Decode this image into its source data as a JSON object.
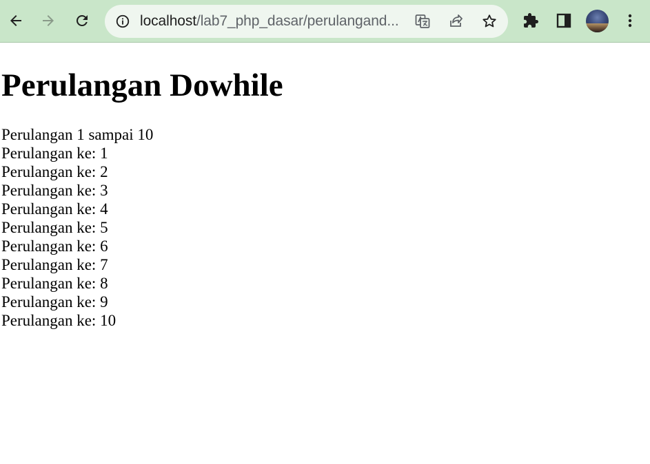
{
  "browser": {
    "url_host": "localhost",
    "url_path": "/lab7_php_dasar/perulangand..."
  },
  "page": {
    "title": "Perulangan Dowhile",
    "subtitle": "Perulangan 1 sampai 10",
    "lines": [
      "Perulangan ke: 1",
      "Perulangan ke: 2",
      "Perulangan ke: 3",
      "Perulangan ke: 4",
      "Perulangan ke: 5",
      "Perulangan ke: 6",
      "Perulangan ke: 7",
      "Perulangan ke: 8",
      "Perulangan ke: 9",
      "Perulangan ke: 10"
    ]
  },
  "icons": {
    "back": "back-arrow-icon",
    "forward": "forward-arrow-icon",
    "reload": "reload-icon",
    "info": "info-icon",
    "translate": "translate-icon",
    "share": "share-icon",
    "bookmark": "star-icon",
    "extensions": "puzzle-icon",
    "side_panel": "side-panel-icon",
    "menu": "kebab-menu-icon"
  },
  "colors": {
    "toolbar": "#c9e6c9",
    "omnibox": "#eff6ef",
    "icon": "#1f1f1f",
    "icon_disabled": "#8a9a8a"
  }
}
